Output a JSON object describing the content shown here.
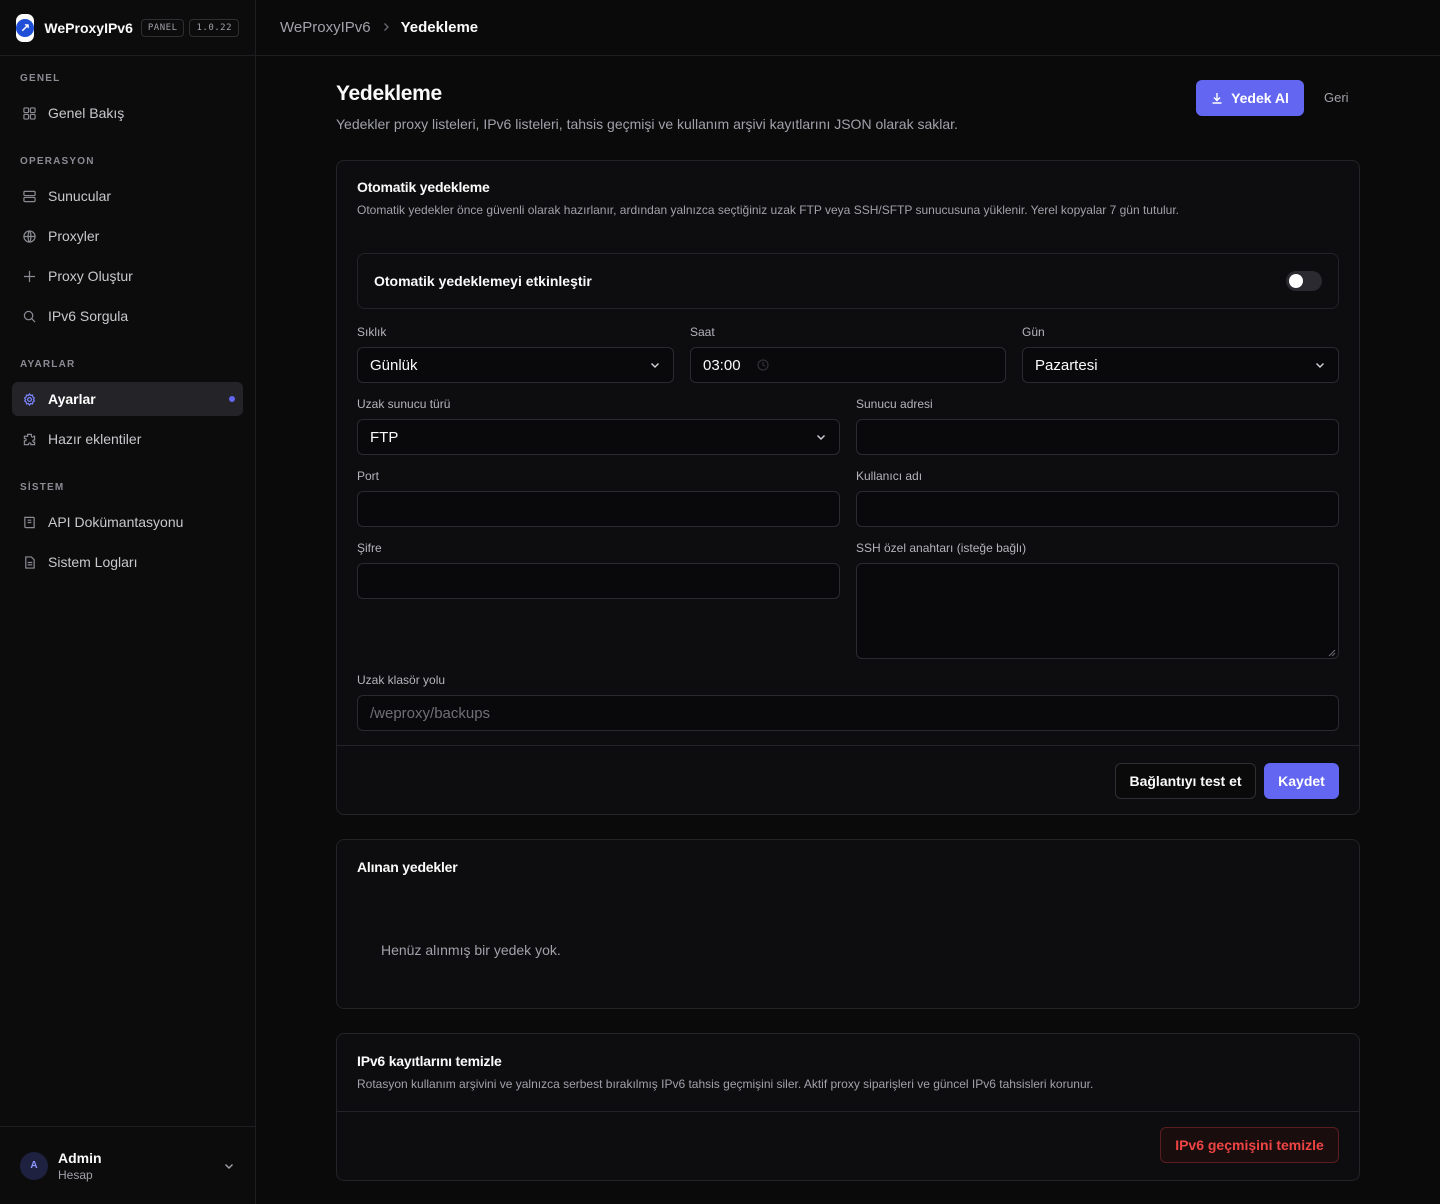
{
  "brand": {
    "name": "WeProxyIPv6",
    "badge_panel": "PANEL",
    "badge_version": "1.0.22"
  },
  "breadcrumb": {
    "root": "WeProxyIPv6",
    "current": "Yedekleme"
  },
  "sidebar": {
    "sections": [
      {
        "heading": "GENEL",
        "items": [
          {
            "label": "Genel Bakış",
            "icon": "grid-icon"
          }
        ]
      },
      {
        "heading": "OPERASYON",
        "items": [
          {
            "label": "Sunucular",
            "icon": "server-icon"
          },
          {
            "label": "Proxyler",
            "icon": "globe-icon"
          },
          {
            "label": "Proxy Oluştur",
            "icon": "plus-icon"
          },
          {
            "label": "IPv6 Sorgula",
            "icon": "search-icon"
          }
        ]
      },
      {
        "heading": "AYARLAR",
        "items": [
          {
            "label": "Ayarlar",
            "icon": "gear-icon",
            "active": true
          },
          {
            "label": "Hazır eklentiler",
            "icon": "puzzle-icon"
          }
        ]
      },
      {
        "heading": "SİSTEM",
        "items": [
          {
            "label": "API Dokümantasyonu",
            "icon": "book-icon"
          },
          {
            "label": "Sistem Logları",
            "icon": "file-icon"
          }
        ]
      }
    ]
  },
  "account": {
    "initial": "A",
    "name": "Admin",
    "subtitle": "Hesap"
  },
  "page": {
    "title": "Yedekleme",
    "description": "Yedekler proxy listeleri, IPv6 listeleri, tahsis geçmişi ve kullanım arşivi kayıtlarını JSON olarak saklar.",
    "backup_button": "Yedek Al",
    "back_link": "Geri"
  },
  "auto_backup": {
    "title": "Otomatik yedekleme",
    "description": "Otomatik yedekler önce güvenli olarak hazırlanır, ardından yalnızca seçtiğiniz uzak FTP veya SSH/SFTP sunucusuna yüklenir. Yerel kopyalar 7 gün tutulur.",
    "toggle_label": "Otomatik yedeklemeyi etkinleştir",
    "enabled": false,
    "frequency": {
      "label": "Sıklık",
      "value": "Günlük"
    },
    "time": {
      "label": "Saat",
      "value": "03:00"
    },
    "day": {
      "label": "Gün",
      "value": "Pazartesi"
    },
    "server_type": {
      "label": "Uzak sunucu türü",
      "value": "FTP"
    },
    "server_address": {
      "label": "Sunucu adresi",
      "value": ""
    },
    "port": {
      "label": "Port",
      "value": ""
    },
    "username": {
      "label": "Kullanıcı adı",
      "value": ""
    },
    "password": {
      "label": "Şifre",
      "value": ""
    },
    "ssh_key": {
      "label": "SSH özel anahtarı (isteğe bağlı)",
      "value": ""
    },
    "remote_path": {
      "label": "Uzak klasör yolu",
      "placeholder": "/weproxy/backups"
    },
    "test_button": "Bağlantıyı test et",
    "save_button": "Kaydet"
  },
  "backups": {
    "title": "Alınan yedekler",
    "empty_text": "Henüz alınmış bir yedek yok."
  },
  "cleanup": {
    "title": "IPv6 kayıtlarını temizle",
    "description": "Rotasyon kullanım arşivini ve yalnızca serbest bırakılmış IPv6 tahsis geçmişini siler. Aktif proxy siparişleri ve güncel IPv6 tahsisleri korunur.",
    "button": "IPv6 geçmişini temizle"
  },
  "colors": {
    "accent": "#6366f1",
    "danger": "#ef4444",
    "background": "#0a0a0b"
  }
}
